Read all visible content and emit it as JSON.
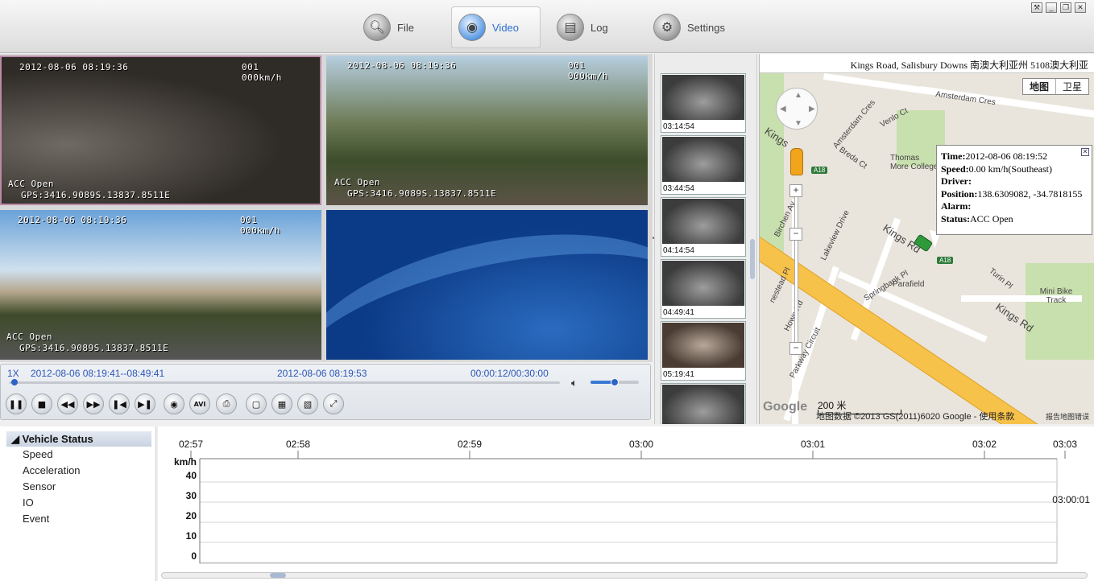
{
  "nav": {
    "items": [
      {
        "label": "File",
        "icon": "search-icon"
      },
      {
        "label": "Video",
        "icon": "camera-icon",
        "active": true
      },
      {
        "label": "Log",
        "icon": "log-icon"
      },
      {
        "label": "Settings",
        "icon": "settings-icon"
      }
    ]
  },
  "videos": {
    "cam1": {
      "datetime": "2012-08-06 08:19:36",
      "channel": "001",
      "speed": "000km/h",
      "acc": "ACC Open",
      "gps": "GPS:3416.9089S.13837.8511E"
    },
    "cam2": {
      "datetime": "2012-08-06 08:19:36",
      "channel": "001",
      "speed": "000km/h",
      "acc": "ACC Open",
      "gps": "GPS:3416.9089S.13837.8511E"
    },
    "cam3": {
      "datetime": "2012-08-06 08:19:36",
      "channel": "001",
      "speed": "000km/h",
      "acc": "ACC Open",
      "gps": "GPS:3416.9089S.13837.8511E"
    }
  },
  "playback": {
    "speed": "1X",
    "range": "2012-08-06 08:19:41--08:49:41",
    "current": "2012-08-06 08:19:53",
    "elapsed": "00:00:12/00:30:00",
    "progress": 0.007,
    "volume": 0.5
  },
  "thumbnails": [
    "03:14:54",
    "03:44:54",
    "04:14:54",
    "04:49:41",
    "05:19:41",
    ""
  ],
  "map": {
    "address": "Kings Road, Salisbury Downs 南澳大利亚州 5108澳大利亚",
    "types": [
      "地图",
      "卫星"
    ],
    "info": {
      "time_label": "Time:",
      "time": "2012-08-06 08:19:52",
      "speed_label": "Speed:",
      "speed": "0.00 km/h(Southeast)",
      "driver_label": "Driver:",
      "driver": "",
      "position_label": "Position:",
      "position": "138.6309082, -34.7818155",
      "alarm_label": "Alarm:",
      "alarm": "",
      "status_label": "Status:",
      "status": "ACC Open"
    },
    "scale": "200 米",
    "google": "Google",
    "copyright": "地图数据 ©2013 GS(2011)6020 Google - 使用条款",
    "report": "报告地图错误",
    "labels": {
      "kings_rd_1": "Kings Rd",
      "kings_rd_2": "Kings Rd",
      "kings_rd_3": "Kings",
      "amsterdam_1": "Amsterdam Cres",
      "amsterdam_2": "Amsterdam Cres",
      "venlo": "Venlo Ct",
      "breda": "Breda Ct",
      "thomas": "Thomas More College",
      "lakeview": "Lakeview Drive",
      "birchen": "Birchen Av",
      "springbank": "Springbank Pl",
      "parafield": "Parafield",
      "howe": "Howe Rd",
      "parkway": "Parkway Circuit",
      "turin": "Turin Pl",
      "minibike": "Mini Bike Track",
      "nestead": "nestead Pl",
      "a18": "A18"
    }
  },
  "tree": {
    "title": "Vehicle Status",
    "items": [
      "Speed",
      "Acceleration",
      "Sensor",
      "IO",
      "Event"
    ]
  },
  "chart_data": {
    "type": "line",
    "x_ticks": [
      "02:57",
      "02:58",
      "02:59",
      "03:00",
      "03:01",
      "03:02",
      "03:03"
    ],
    "ylabel": "km/h",
    "y_ticks": [
      40,
      30,
      20,
      10,
      0
    ],
    "ylim": [
      0,
      40
    ],
    "series": [],
    "annotation": "03:00:01",
    "grid": true
  }
}
